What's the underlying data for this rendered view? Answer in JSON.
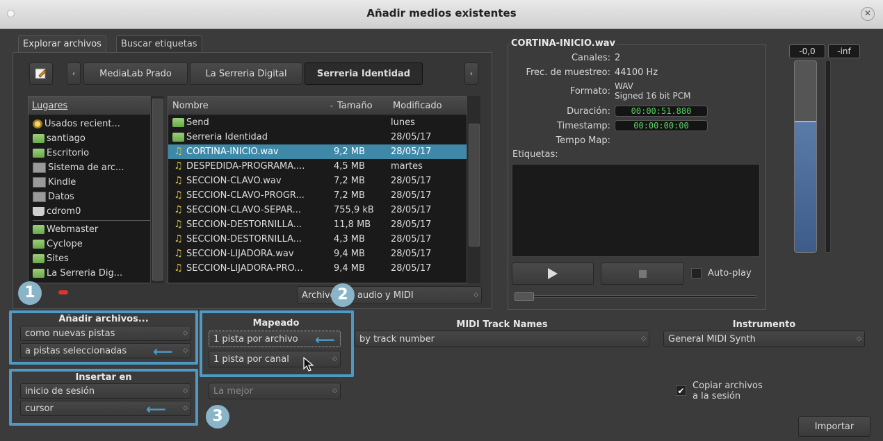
{
  "window": {
    "title": "Añadir medios existentes"
  },
  "tabs": [
    "Explorar archivos",
    "Buscar etiquetas"
  ],
  "breadcrumbs": [
    "MediaLab Prado",
    "La Serreria Digital",
    "Serreria Identidad"
  ],
  "places": {
    "header": "Lugares",
    "items": [
      "Usados recient...",
      "santiago",
      "Escritorio",
      "Sistema de arc...",
      "Kindle",
      "Datos",
      "cdrom0"
    ],
    "bookmarks": [
      "Webmaster",
      "Cyclope",
      "Sites",
      "La Serreria Dig..."
    ]
  },
  "files": {
    "columns": [
      "Nombre",
      "Tamaño",
      "Modificado"
    ],
    "rows": [
      {
        "name": "Send",
        "size": "",
        "modified": "lunes",
        "type": "folder"
      },
      {
        "name": "Serreria Identidad",
        "size": "",
        "modified": "28/05/17",
        "type": "folder"
      },
      {
        "name": "CORTINA-INICIO.wav",
        "size": "9,2 MB",
        "modified": "28/05/17",
        "type": "audio"
      },
      {
        "name": "DESPEDIDA-PROGRAMA....",
        "size": "4,5 MB",
        "modified": "martes",
        "type": "audio"
      },
      {
        "name": "SECCION-CLAVO.wav",
        "size": "7,2 MB",
        "modified": "28/05/17",
        "type": "audio"
      },
      {
        "name": "SECCION-CLAVO-PROGR...",
        "size": "7,2 MB",
        "modified": "28/05/17",
        "type": "audio"
      },
      {
        "name": "SECCION-CLAVO-SEPAR...",
        "size": "755,9 kB",
        "modified": "28/05/17",
        "type": "audio"
      },
      {
        "name": "SECCION-DESTORNILLA...",
        "size": "11,8 MB",
        "modified": "28/05/17",
        "type": "audio"
      },
      {
        "name": "SECCION-DESTORNILLA...",
        "size": "4,3 MB",
        "modified": "28/05/17",
        "type": "audio"
      },
      {
        "name": "SECCION-LIJADORA.wav",
        "size": "9,4 MB",
        "modified": "28/05/17",
        "type": "audio"
      },
      {
        "name": "SECCION-LIJADORA-PRO...",
        "size": "9,4 MB",
        "modified": "28/05/17",
        "type": "audio"
      }
    ],
    "filter": "Archivos de audio y MIDI"
  },
  "info": {
    "filename": "CORTINA-INICIO.wav",
    "channels_label": "Canales:",
    "channels": "2",
    "rate_label": "Frec. de muestreo:",
    "rate": "44100 Hz",
    "format_label": "Formato:",
    "format1": "WAV",
    "format2": "Signed 16 bit PCM",
    "duration_label": "Duración:",
    "duration": "00:00:51.880",
    "timestamp_label": "Timestamp:",
    "timestamp": "00:00:00:00",
    "tempo_label": "Tempo Map:",
    "tags_label": "Etiquetas:",
    "autoplay": "Auto-play"
  },
  "meter": {
    "peak": "-0,0",
    "inf": "-inf",
    "level": 0.68
  },
  "add_files": {
    "title": "Añadir archivos...",
    "as": "como nuevas pistas",
    "to": "a pistas seleccionadas"
  },
  "insert_at": {
    "title": "Insertar en",
    "where": "inicio de sesión",
    "pos": "cursor"
  },
  "mapping": {
    "title": "Mapeado",
    "file": "1 pista por archivo",
    "channel": "1 pista por canal"
  },
  "quality": "La mejor",
  "midi": {
    "title": "MIDI Track Names",
    "value": "by track number"
  },
  "instrument": {
    "title": "Instrumento",
    "value": "General MIDI Synth"
  },
  "copy_files": {
    "line1": "Copiar archivos",
    "line2": "a la sesión"
  },
  "import_btn": "Importar",
  "badges": [
    "1",
    "2",
    "3"
  ]
}
